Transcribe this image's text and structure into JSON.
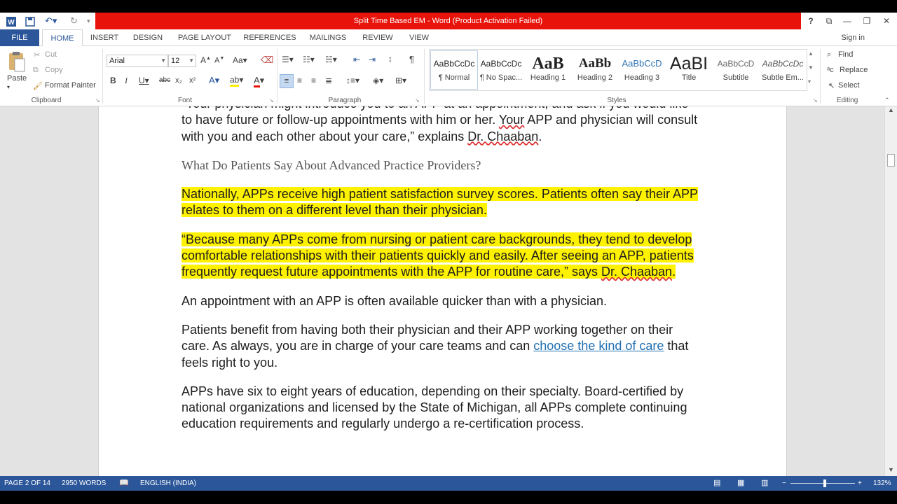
{
  "window": {
    "title": "Split Time Based EM -  Word (Product Activation Failed)",
    "help_label": "?",
    "signin_label": "Sign in"
  },
  "tabs": [
    "FILE",
    "HOME",
    "INSERT",
    "DESIGN",
    "PAGE LAYOUT",
    "REFERENCES",
    "MAILINGS",
    "REVIEW",
    "VIEW"
  ],
  "clipboard": {
    "paste_label": "Paste",
    "cut_label": "Cut",
    "copy_label": "Copy",
    "format_painter_label": "Format Painter",
    "group_label": "Clipboard"
  },
  "font": {
    "family": "Arial",
    "size": "12",
    "group_label": "Font"
  },
  "paragraph": {
    "group_label": "Paragraph"
  },
  "styles": {
    "group_label": "Styles",
    "items": [
      {
        "preview": "AaBbCcDc",
        "name": "¶ Normal"
      },
      {
        "preview": "AaBbCcDc",
        "name": "¶ No Spac..."
      },
      {
        "preview": "AaB",
        "name": "Heading 1"
      },
      {
        "preview": "AaBb",
        "name": "Heading 2"
      },
      {
        "preview": "AaBbCcD",
        "name": "Heading 3"
      },
      {
        "preview": "AaBI",
        "name": "Title"
      },
      {
        "preview": "AaBbCcD",
        "name": "Subtitle"
      },
      {
        "preview": "AaBbCcDc",
        "name": "Subtle Em..."
      }
    ]
  },
  "editing": {
    "find_label": "Find",
    "replace_label": "Replace",
    "select_label": "Select",
    "group_label": "Editing"
  },
  "document": {
    "p1_a": "“Your physician might introduce you to an APP at an appointment, and ask if you would like to have future or follow-up appointments with him or her. ",
    "p1_your": "Your",
    "p1_b": " APP and physician will consult with you and each other about your care,” explains ",
    "p1_dr": "Dr. Chaaban",
    "p1_c": ".",
    "heading": "What Do Patients Say About Advanced Practice Providers?",
    "p2": "Nationally, APPs receive high patient satisfaction survey scores. Patients often say their APP relates to them on a different level than their physician.",
    "p3_a": "“Because many APPs come from nursing or patient care backgrounds, they tend to develop comfortable relationships with their patients quickly and easily. After seeing an APP, patients frequently request future appointments with the APP for routine care,” says ",
    "p3_dr": "Dr. Chaaban",
    "p3_c": ".",
    "p4": "An appointment with an APP is often available quicker than with a physician.",
    "p5_a": "Patients benefit from having both their physician and their APP working together on their care. As always, you are in charge of your care teams and can ",
    "p5_link": "choose the kind of care",
    "p5_c": " that feels right to you.",
    "p6": "APPs have six to eight years of education, depending on their specialty. Board-certified by national organizations and licensed by the State of Michigan, all APPs complete continuing education requirements and regularly undergo a re-certification process."
  },
  "status": {
    "page": "PAGE 2 OF 14",
    "words": "2950 WORDS",
    "language": "ENGLISH (INDIA)",
    "zoom": "132%"
  },
  "colors": {
    "word_blue": "#2b579a",
    "title_red": "#e8140c",
    "highlight": "#fff200",
    "link": "#1f6fb2"
  }
}
